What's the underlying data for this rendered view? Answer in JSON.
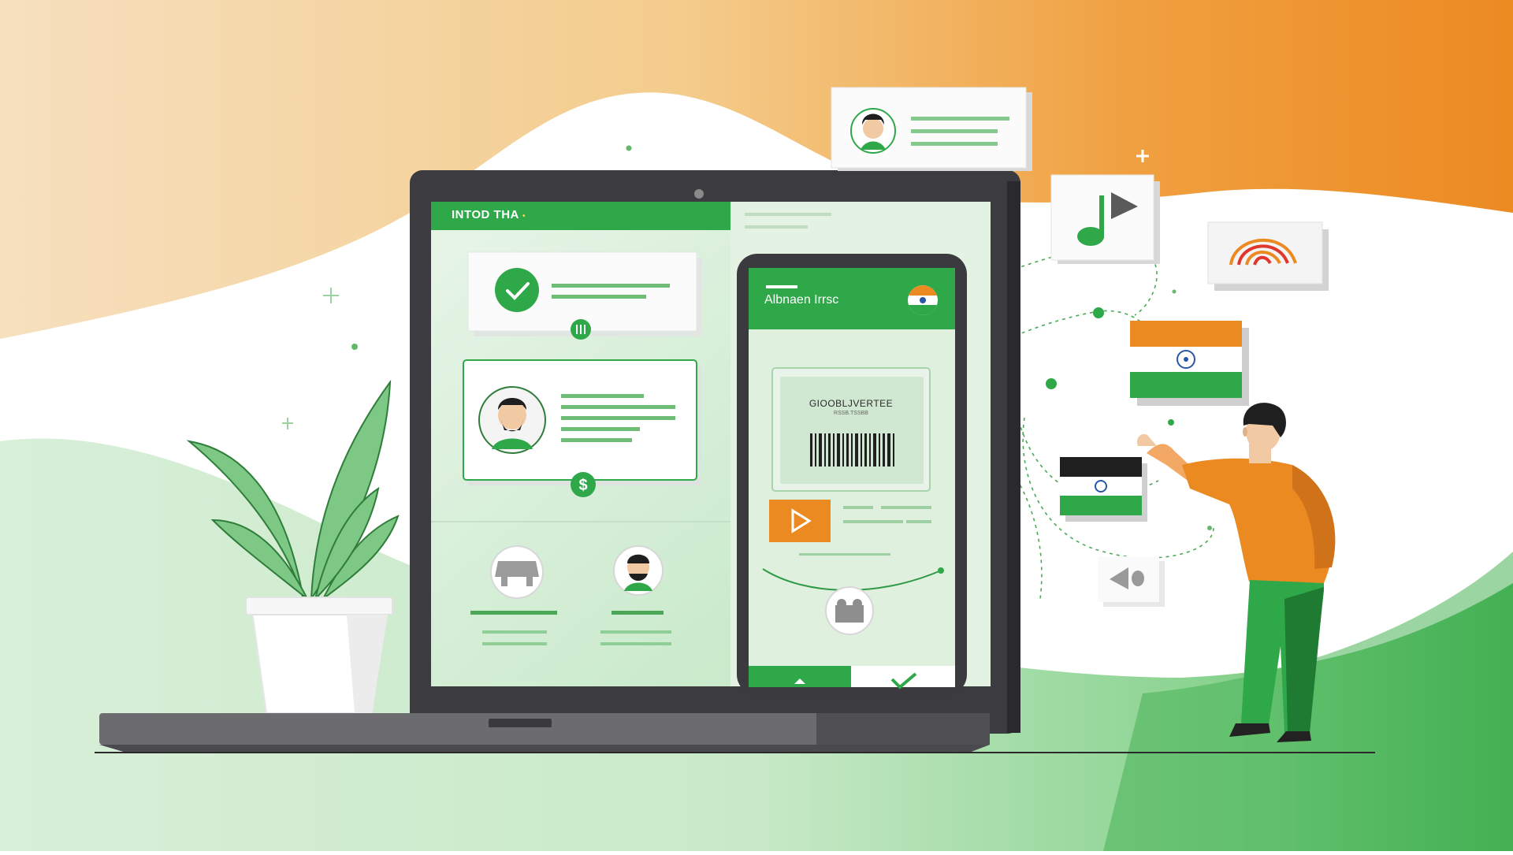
{
  "laptop": {
    "screen_title": "INTOD THA",
    "screen_title_dot": "•"
  },
  "phone": {
    "header_title": "Albnaen Irrsc",
    "ticket_code": "GIOOBLJVERTEE",
    "ticket_subcode": "RSSB.TSSBB"
  },
  "icons": {
    "check": "check-circle-icon",
    "dollar": "dollar-badge-icon",
    "bank": "bank-badge-icon",
    "music": "music-note-icon",
    "play": "play-icon",
    "aadhaar": "aadhaar-fingerprint-icon",
    "flag": "india-flag-icon"
  },
  "colors": {
    "green": "#2fa84a",
    "light_green": "#e6f4e6",
    "orange": "#ec8a22",
    "saffron_light": "#f2c98a"
  }
}
